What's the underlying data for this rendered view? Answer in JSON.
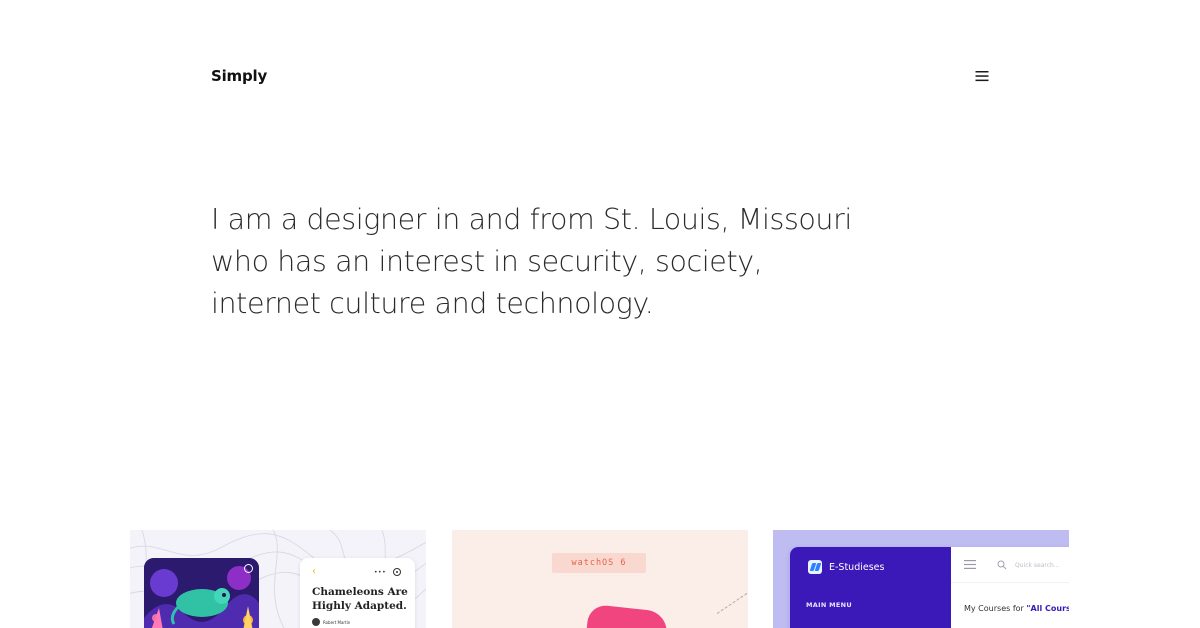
{
  "header": {
    "brand": "Simply",
    "menu_icon": "hamburger-menu-icon"
  },
  "hero": {
    "lines": [
      "I am a designer in and from St. Louis, Missouri",
      "who has an interest in security, society,",
      "internet culture and technology."
    ]
  },
  "projects": [
    {
      "title": "Chameleons Are Highly Adapted.",
      "author": "Robert Martin",
      "back_icon": "chevron-left-icon",
      "more_icon": "ellipsis-icon",
      "target_icon": "target-icon",
      "colors": {
        "background": "#f3f3f9",
        "art": "#2b1a6e",
        "accent": "#f0b400"
      }
    },
    {
      "badge": "watchOS 6",
      "colors": {
        "background": "#fbeee9",
        "badge_bg": "#f9d8cf",
        "badge_text": "#e8634a",
        "shape": "#f0457e"
      }
    },
    {
      "app_name": "E-Studieses",
      "menu_heading": "MAIN MENU",
      "search_placeholder": "Quick search...",
      "courses_prefix": "My Courses for ",
      "courses_highlight": "\"All Courses\"",
      "colors": {
        "background": "#bfbcf1",
        "sidebar": "#3b19b8"
      }
    }
  ]
}
